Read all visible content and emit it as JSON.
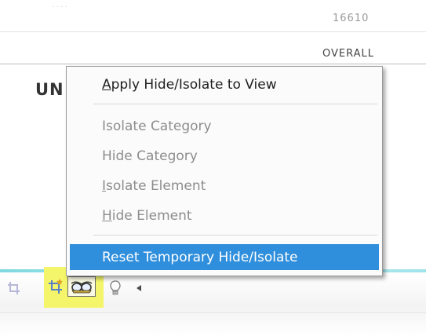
{
  "background": {
    "faint_text": "····",
    "sheet_number": "16610",
    "overall_label": "OVERALL",
    "partial_title": "UN"
  },
  "context_menu": {
    "items": [
      {
        "accel": "A",
        "rest": "pply Hide/Isolate to View",
        "state": "enabled"
      },
      {
        "pre": "Isolate Category",
        "state": "disabled"
      },
      {
        "pre": "Hide Category",
        "state": "disabled"
      },
      {
        "accel": "I",
        "rest": "solate Element",
        "state": "disabled"
      },
      {
        "accel": "H",
        "rest": "ide Element",
        "state": "disabled"
      },
      {
        "pre": "Reset Temporary Hide/Isolate",
        "state": "selected"
      }
    ]
  },
  "view_control_bar": {
    "tools": [
      {
        "icon": "crop-region-icon",
        "highlighted": false
      },
      {
        "icon": "show-crop-region-icon",
        "highlighted": true
      },
      {
        "icon": "temporary-hide-isolate-icon",
        "highlighted": true
      },
      {
        "icon": "reveal-hidden-elements-icon",
        "highlighted": false
      },
      {
        "icon": "scroll-left-arrow-icon",
        "highlighted": false
      }
    ]
  },
  "colors": {
    "menu_selection": "#2f8fdc",
    "highlight": "#f4f56a",
    "cyan_band": "#9fe3ea",
    "disabled_text": "#8d8d8d"
  }
}
